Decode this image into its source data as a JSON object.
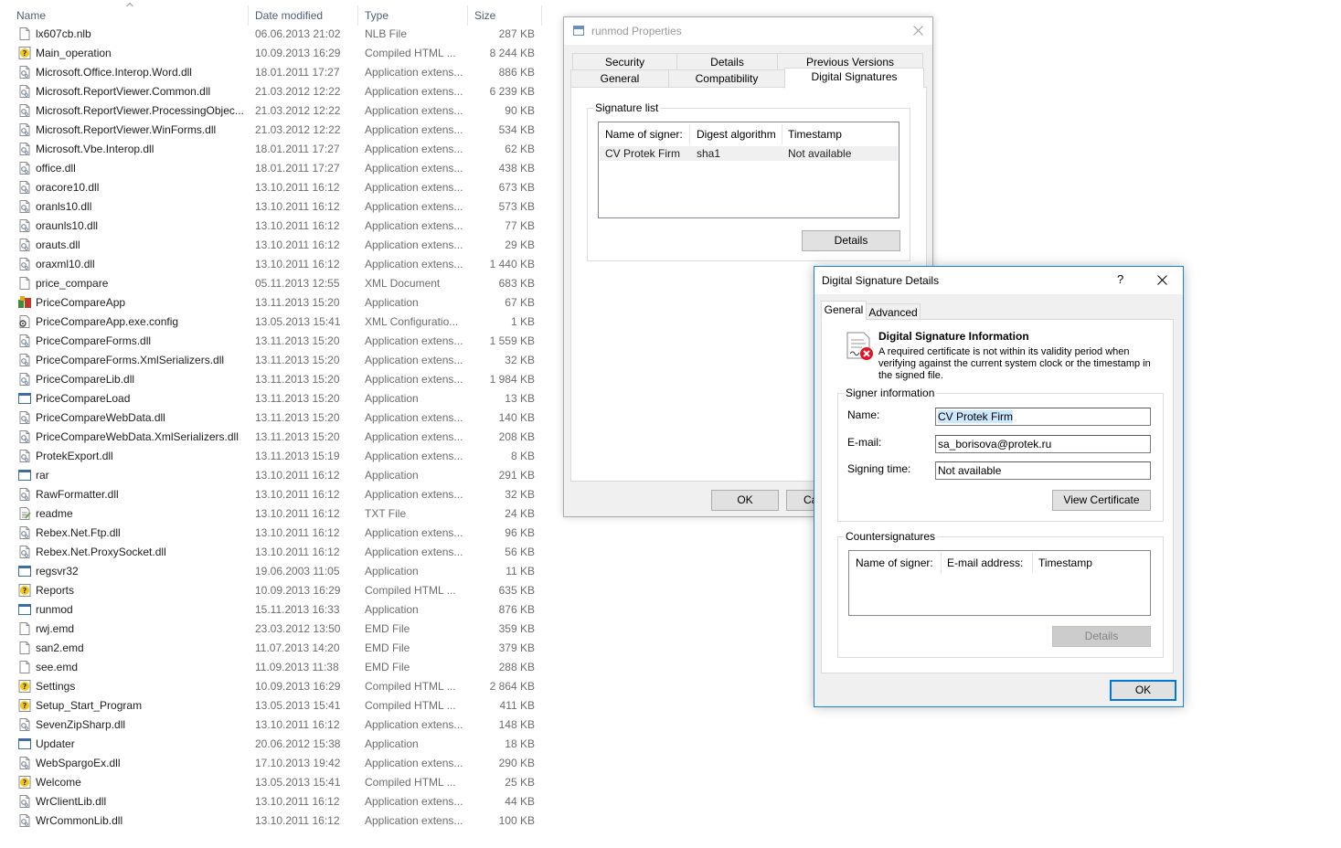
{
  "explorer": {
    "columns": {
      "name": "Name",
      "date": "Date modified",
      "type": "Type",
      "size": "Size"
    },
    "files": [
      {
        "name": "lx607cb.nlb",
        "date": "06.06.2013 21:02",
        "type": "NLB File",
        "size": "287 KB",
        "icon": "file-icon"
      },
      {
        "name": "Main_operation",
        "date": "10.09.2013 16:29",
        "type": "Compiled HTML ...",
        "size": "8 244 KB",
        "icon": "chm-icon"
      },
      {
        "name": "Microsoft.Office.Interop.Word.dll",
        "date": "18.01.2011 17:27",
        "type": "Application extens...",
        "size": "886 KB",
        "icon": "dll-icon"
      },
      {
        "name": "Microsoft.ReportViewer.Common.dll",
        "date": "21.03.2012 12:22",
        "type": "Application extens...",
        "size": "6 239 KB",
        "icon": "dll-icon"
      },
      {
        "name": "Microsoft.ReportViewer.ProcessingObjec...",
        "date": "21.03.2012 12:22",
        "type": "Application extens...",
        "size": "90 KB",
        "icon": "dll-icon"
      },
      {
        "name": "Microsoft.ReportViewer.WinForms.dll",
        "date": "21.03.2012 12:22",
        "type": "Application extens...",
        "size": "534 KB",
        "icon": "dll-icon"
      },
      {
        "name": "Microsoft.Vbe.Interop.dll",
        "date": "18.01.2011 17:27",
        "type": "Application extens...",
        "size": "62 KB",
        "icon": "dll-icon"
      },
      {
        "name": "office.dll",
        "date": "18.01.2011 17:27",
        "type": "Application extens...",
        "size": "438 KB",
        "icon": "dll-icon"
      },
      {
        "name": "oracore10.dll",
        "date": "13.10.2011 16:12",
        "type": "Application extens...",
        "size": "673 KB",
        "icon": "dll-icon"
      },
      {
        "name": "oranls10.dll",
        "date": "13.10.2011 16:12",
        "type": "Application extens...",
        "size": "573 KB",
        "icon": "dll-icon"
      },
      {
        "name": "oraunls10.dll",
        "date": "13.10.2011 16:12",
        "type": "Application extens...",
        "size": "77 KB",
        "icon": "dll-icon"
      },
      {
        "name": "orauts.dll",
        "date": "13.10.2011 16:12",
        "type": "Application extens...",
        "size": "29 KB",
        "icon": "dll-icon"
      },
      {
        "name": "oraxml10.dll",
        "date": "13.10.2011 16:12",
        "type": "Application extens...",
        "size": "1 440 KB",
        "icon": "dll-icon"
      },
      {
        "name": "price_compare",
        "date": "05.11.2013 12:55",
        "type": "XML Document",
        "size": "683 KB",
        "icon": "file-icon"
      },
      {
        "name": "PriceCompareApp",
        "date": "13.11.2013 15:20",
        "type": "Application",
        "size": "67 KB",
        "icon": "pricecompare-app-icon"
      },
      {
        "name": "PriceCompareApp.exe.config",
        "date": "13.05.2013 15:41",
        "type": "XML Configuratio...",
        "size": "1 KB",
        "icon": "config-icon"
      },
      {
        "name": "PriceCompareForms.dll",
        "date": "13.11.2013 15:20",
        "type": "Application extens...",
        "size": "1 559 KB",
        "icon": "dll-icon"
      },
      {
        "name": "PriceCompareForms.XmlSerializers.dll",
        "date": "13.11.2013 15:20",
        "type": "Application extens...",
        "size": "32 KB",
        "icon": "dll-icon"
      },
      {
        "name": "PriceCompareLib.dll",
        "date": "13.11.2013 15:20",
        "type": "Application extens...",
        "size": "1 984 KB",
        "icon": "dll-icon"
      },
      {
        "name": "PriceCompareLoad",
        "date": "13.11.2013 15:20",
        "type": "Application",
        "size": "13 KB",
        "icon": "exe-icon"
      },
      {
        "name": "PriceCompareWebData.dll",
        "date": "13.11.2013 15:20",
        "type": "Application extens...",
        "size": "140 KB",
        "icon": "dll-icon"
      },
      {
        "name": "PriceCompareWebData.XmlSerializers.dll",
        "date": "13.11.2013 15:20",
        "type": "Application extens...",
        "size": "208 KB",
        "icon": "dll-icon"
      },
      {
        "name": "ProtekExport.dll",
        "date": "13.11.2013 15:19",
        "type": "Application extens...",
        "size": "8 KB",
        "icon": "dll-icon"
      },
      {
        "name": "rar",
        "date": "13.10.2011 16:12",
        "type": "Application",
        "size": "291 KB",
        "icon": "exe-icon"
      },
      {
        "name": "RawFormatter.dll",
        "date": "13.10.2011 16:12",
        "type": "Application extens...",
        "size": "32 KB",
        "icon": "dll-icon"
      },
      {
        "name": "readme",
        "date": "13.10.2011 16:12",
        "type": "TXT File",
        "size": "24 KB",
        "icon": "txt-icon"
      },
      {
        "name": "Rebex.Net.Ftp.dll",
        "date": "13.10.2011 16:12",
        "type": "Application extens...",
        "size": "96 KB",
        "icon": "dll-icon"
      },
      {
        "name": "Rebex.Net.ProxySocket.dll",
        "date": "13.10.2011 16:12",
        "type": "Application extens...",
        "size": "56 KB",
        "icon": "dll-icon"
      },
      {
        "name": "regsvr32",
        "date": "19.06.2003 11:05",
        "type": "Application",
        "size": "11 KB",
        "icon": "exe-icon"
      },
      {
        "name": "Reports",
        "date": "10.09.2013 16:29",
        "type": "Compiled HTML ...",
        "size": "635 KB",
        "icon": "chm-icon"
      },
      {
        "name": "runmod",
        "date": "15.11.2013 16:33",
        "type": "Application",
        "size": "876 KB",
        "icon": "exe-icon"
      },
      {
        "name": "rwj.emd",
        "date": "23.03.2012 13:50",
        "type": "EMD File",
        "size": "359 KB",
        "icon": "file-icon"
      },
      {
        "name": "san2.emd",
        "date": "11.07.2013 14:20",
        "type": "EMD File",
        "size": "379 KB",
        "icon": "file-icon"
      },
      {
        "name": "see.emd",
        "date": "11.09.2013 11:38",
        "type": "EMD File",
        "size": "288 KB",
        "icon": "file-icon"
      },
      {
        "name": "Settings",
        "date": "10.09.2013 16:29",
        "type": "Compiled HTML ...",
        "size": "2 864 KB",
        "icon": "chm-icon"
      },
      {
        "name": "Setup_Start_Program",
        "date": "13.05.2013 15:41",
        "type": "Compiled HTML ...",
        "size": "411 KB",
        "icon": "chm-icon"
      },
      {
        "name": "SevenZipSharp.dll",
        "date": "13.10.2011 16:12",
        "type": "Application extens...",
        "size": "148 KB",
        "icon": "dll-icon"
      },
      {
        "name": "Updater",
        "date": "20.06.2012 15:38",
        "type": "Application",
        "size": "18 KB",
        "icon": "exe-icon"
      },
      {
        "name": "WebSpargoEx.dll",
        "date": "17.10.2013 19:42",
        "type": "Application extens...",
        "size": "290 KB",
        "icon": "dll-icon"
      },
      {
        "name": "Welcome",
        "date": "13.05.2013 15:41",
        "type": "Compiled HTML ...",
        "size": "25 KB",
        "icon": "chm-icon"
      },
      {
        "name": "WrClientLib.dll",
        "date": "13.10.2011 16:12",
        "type": "Application extens...",
        "size": "44 KB",
        "icon": "dll-icon"
      },
      {
        "name": "WrCommonLib.dll",
        "date": "13.10.2011 16:12",
        "type": "Application extens...",
        "size": "100 KB",
        "icon": "dll-icon"
      }
    ]
  },
  "props": {
    "title": "runmod Properties",
    "tabs_row1": [
      "Security",
      "Details",
      "Previous Versions"
    ],
    "tabs_row2": [
      "General",
      "Compatibility",
      "Digital Signatures"
    ],
    "group_title": "Signature list",
    "columns": [
      "Name of signer:",
      "Digest algorithm",
      "Timestamp"
    ],
    "row": [
      "CV Protek Firm",
      "sha1",
      "Not available"
    ],
    "details_btn": "Details",
    "ok_btn": "OK",
    "cancel_btn": "Ca"
  },
  "dsd": {
    "title": "Digital Signature Details",
    "help": "?",
    "tabs": [
      "General",
      "Advanced"
    ],
    "info_title": "Digital Signature Information",
    "info_text": "A required certificate is not within its validity period when verifying against the current system clock or the timestamp in the signed file.",
    "signer_group": "Signer information",
    "name_label": "Name:",
    "name_value": "CV Protek Firm",
    "email_label": "E-mail:",
    "email_value": "sa_borisova@protek.ru",
    "time_label": "Signing time:",
    "time_value": "Not available",
    "view_cert_btn": "View Certificate",
    "counter_group": "Countersignatures",
    "counter_columns": [
      "Name of signer:",
      "E-mail address:",
      "Timestamp"
    ],
    "details_btn": "Details",
    "ok_btn": "OK"
  },
  "colors": {
    "accent": "#0078d7",
    "selection": "#cce8ff",
    "dialog_bg": "#f0f0f0",
    "error": "#e81123"
  }
}
